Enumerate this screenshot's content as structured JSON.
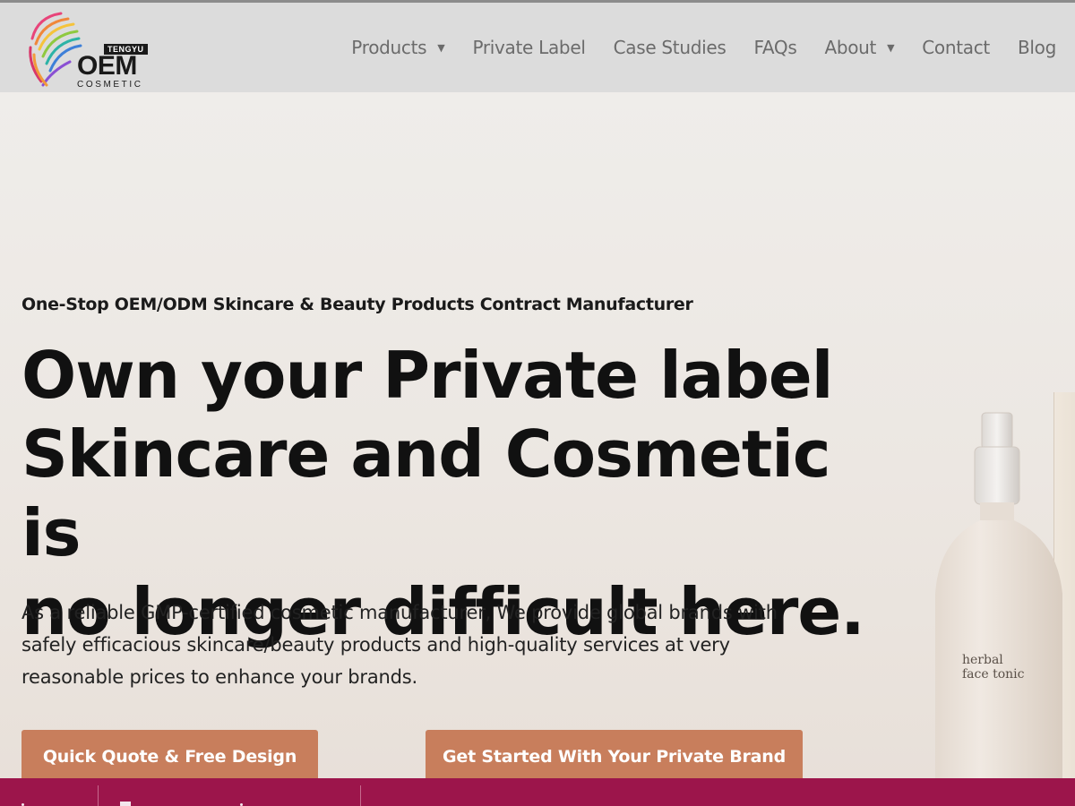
{
  "logo": {
    "top_text": "TENGYU",
    "main_text": "OEM",
    "sub_text": "COSMETIC"
  },
  "nav": {
    "items": [
      {
        "label": "Products",
        "has_dropdown": true
      },
      {
        "label": "Private Label",
        "has_dropdown": false
      },
      {
        "label": "Case Studies",
        "has_dropdown": false
      },
      {
        "label": "FAQs",
        "has_dropdown": false
      },
      {
        "label": "About",
        "has_dropdown": true
      },
      {
        "label": "Contact",
        "has_dropdown": false
      },
      {
        "label": "Blog",
        "has_dropdown": false
      }
    ],
    "dropdown_icon": "caret-down-icon"
  },
  "hero": {
    "eyebrow": "One-Stop OEM/ODM Skincare & Beauty Products Contract Manufacturer",
    "headline_line1": "Own your Private label",
    "headline_line2": "Skincare and Cosmetic is",
    "headline_line3": "no longer difficult here.",
    "lede_line1": "As a reliable GMP-certified cosmetic manufacturer, We provide global brands with",
    "lede_line2": "safely efficacious skincare/beauty products and high-quality services at very",
    "lede_line3": "reasonable prices to enhance your brands.",
    "cta_primary": "Quick Quote & Free Design",
    "cta_secondary": "Get Started With Your Private Brand",
    "product_label_line1": "herbal",
    "product_label_line2": "face tonic"
  },
  "colors": {
    "header_bg": "#dcdcdc",
    "cta": "#c87e5c",
    "footer_bar": "#9c154b"
  }
}
